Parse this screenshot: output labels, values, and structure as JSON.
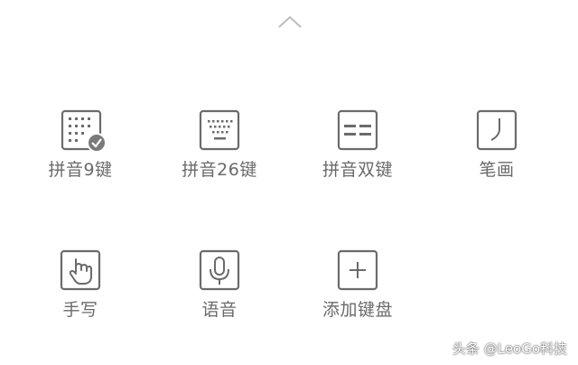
{
  "panel": {
    "collapse_icon": "chevron-up-icon",
    "items": [
      {
        "label": "拼音9键",
        "icon": "keypad-9-icon",
        "selected": true
      },
      {
        "label": "拼音26键",
        "icon": "keyboard-26-icon",
        "selected": false
      },
      {
        "label": "拼音双键",
        "icon": "double-key-icon",
        "selected": false
      },
      {
        "label": "笔画",
        "icon": "stroke-icon",
        "selected": false
      },
      {
        "label": "手写",
        "icon": "handwriting-icon",
        "selected": false
      },
      {
        "label": "语音",
        "icon": "microphone-icon",
        "selected": false
      },
      {
        "label": "添加键盘",
        "icon": "add-icon",
        "selected": false
      }
    ]
  },
  "watermark": "头条 @LeoGo科技",
  "colors": {
    "icon": "#6b6b6b",
    "text": "#6a6a6a",
    "background": "#ffffff",
    "check": "#7a7a7a"
  }
}
